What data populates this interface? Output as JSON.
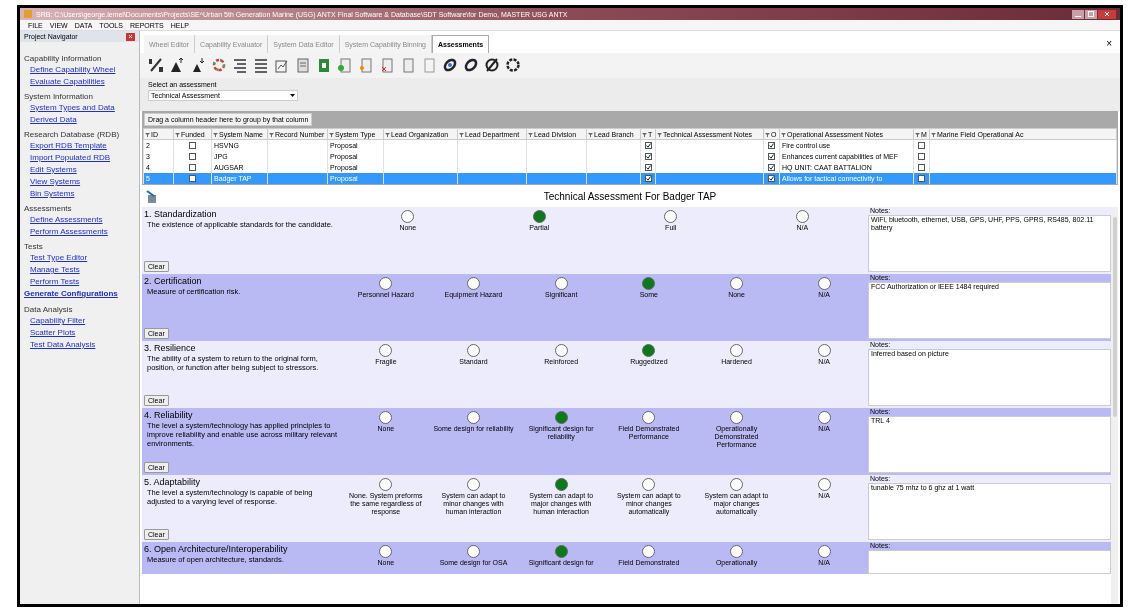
{
  "window": {
    "title": "SRB: C:\\Users\\george.lemel\\Documents\\Projects\\SE^Urban 5th Generation Marine (USG) ANTX Final Software & Database\\SDT Software\\for Demo, MASTER USG ANTX"
  },
  "menu": [
    "FILE",
    "VIEW",
    "DATA",
    "TOOLS",
    "REPORTS",
    "HELP"
  ],
  "navigator": {
    "title": "Project Navigator",
    "groups": [
      {
        "label": "Capability Information",
        "links": [
          "Define Capability Wheel",
          "Evaluate Capabilities"
        ]
      },
      {
        "label": "System Information",
        "links": [
          "System Types and Data",
          "Derived Data"
        ]
      },
      {
        "label": "Research Database (RDB)",
        "links": [
          "Export RDB Template",
          "Import Populated RDB",
          "Edit Systems",
          "View Systems",
          "Bin Systems"
        ]
      },
      {
        "label": "Assessments",
        "links": [
          "Define Assessments",
          "Perform Assessments"
        ]
      },
      {
        "label": "Tests",
        "links": [
          "Test Type Editor",
          "Manage Tests",
          "Perform Tests"
        ]
      },
      {
        "label": "Generate Configurations",
        "kind": "bold-link"
      },
      {
        "label": "Data Analysis",
        "links": [
          "Capability Filter",
          "Scatter Plots",
          "Test Data Analysis"
        ]
      }
    ]
  },
  "tabs": [
    {
      "label": "Wheel Editor",
      "selected": false
    },
    {
      "label": "Capability Evaluator",
      "selected": false
    },
    {
      "label": "System Data Editor",
      "selected": false
    },
    {
      "label": "System Capability Binning",
      "selected": false
    },
    {
      "label": "Assessments",
      "selected": true
    }
  ],
  "tab_close": "×",
  "assessment_select": {
    "label": "Select an assessment",
    "value": "Technical Assessment"
  },
  "group_hint": "Drag a column header here to group by that column",
  "table": {
    "columns": [
      "ID",
      "Funded",
      "System Name",
      "Record Number",
      "System Type",
      "Lead Organization",
      "Lead Department",
      "Lead Division",
      "Lead Branch",
      "T",
      "Technical Assessment Notes",
      "O",
      "Operational Assessment Notes",
      "M",
      "Marine Field Operational Ac"
    ],
    "rows": [
      {
        "id": "2",
        "funded": false,
        "name": "HSVNG",
        "type": "Proposal",
        "t": true,
        "o": true,
        "op_notes": "Fire control use",
        "m": false,
        "selected": false
      },
      {
        "id": "3",
        "funded": false,
        "name": "JPG",
        "type": "Proposal",
        "t": true,
        "o": true,
        "op_notes": "Enhances current capabilities of MEF",
        "m": false,
        "selected": false
      },
      {
        "id": "4",
        "funded": false,
        "name": "AUGSAR",
        "type": "Proposal",
        "t": true,
        "o": true,
        "op_notes": "HQ UNIT: CAAT BATTALION",
        "m": false,
        "selected": false
      },
      {
        "id": "5",
        "funded": false,
        "name": "Badger TAP",
        "type": "Proposal",
        "t": true,
        "o": true,
        "op_notes": "Allows for tactical connectivity to",
        "m": false,
        "selected": true
      }
    ]
  },
  "form": {
    "title": "Technical Assessment For Badger TAP",
    "criteria": [
      {
        "title": "1. Standardization",
        "description": "The existence of applicable standards for the candidate.",
        "clear_label": "Clear",
        "notes_label": "Notes:",
        "notes": "WiFi, bluetooth, ethernet, USB, GPS, UHF, PPS, GPRS, RS485, 802.11 battery",
        "options": [
          {
            "label": "None",
            "selected": false
          },
          {
            "label": "Partial",
            "selected": true
          },
          {
            "label": "Full",
            "selected": false
          },
          {
            "label": "N/A",
            "selected": false
          }
        ]
      },
      {
        "title": "2. Certification",
        "description": "Measure of certification risk.",
        "clear_label": "Clear",
        "notes_label": "Notes:",
        "notes": "FCC Authorization or IEEE 1484 required",
        "options": [
          {
            "label": "Personnel Hazard",
            "selected": false
          },
          {
            "label": "Equipment Hazard",
            "selected": false
          },
          {
            "label": "Significant",
            "selected": false
          },
          {
            "label": "Some",
            "selected": true
          },
          {
            "label": "None",
            "selected": false
          },
          {
            "label": "N/A",
            "selected": false
          }
        ]
      },
      {
        "title": "3. Resilience",
        "description": "The ability of a system to return to the original form, position, or function after being subject to stressors.",
        "clear_label": "Clear",
        "notes_label": "Notes:",
        "notes": "Inferred based on picture",
        "options": [
          {
            "label": "Fragile",
            "selected": false
          },
          {
            "label": "Standard",
            "selected": false
          },
          {
            "label": "Reinforced",
            "selected": false
          },
          {
            "label": "Ruggedized",
            "selected": true
          },
          {
            "label": "Hardened",
            "selected": false
          },
          {
            "label": "N/A",
            "selected": false
          }
        ]
      },
      {
        "title": "4. Reliability",
        "description": "The level a system/technology has applied principles to improve reliability and enable use across military relevant environments.",
        "clear_label": "Clear",
        "notes_label": "Notes:",
        "notes": "TRL 4",
        "options": [
          {
            "label": "None",
            "selected": false
          },
          {
            "label": "Some design for reliability",
            "selected": false
          },
          {
            "label": "Significant design for reliability",
            "selected": true
          },
          {
            "label": "Field Demonstrated Performance",
            "selected": false
          },
          {
            "label": "Operationally Demonstrated Performance",
            "selected": false
          },
          {
            "label": "N/A",
            "selected": false
          }
        ]
      },
      {
        "title": "5. Adaptability",
        "description": "The level a system/technology is capable of being adjusted to a varying level of response.",
        "clear_label": "Clear",
        "notes_label": "Notes:",
        "notes": "tunable 75 mhz to 6 ghz at 1 watt",
        "options": [
          {
            "label": "None. System preforms the same regardless of response",
            "selected": false
          },
          {
            "label": "System can adapt to minor changes with human interaction",
            "selected": false
          },
          {
            "label": "System can adapt to major changes with human interaction",
            "selected": true
          },
          {
            "label": "System can adapt to minor changes automatically",
            "selected": false
          },
          {
            "label": "System can adapt to major changes automatically",
            "selected": false
          },
          {
            "label": "N/A",
            "selected": false
          }
        ]
      },
      {
        "title": "6. Open Architecture/Interoperability",
        "description": "Measure of open architecture, standards.",
        "notes_label": "Notes:",
        "options": [
          {
            "label": "None",
            "selected": false
          },
          {
            "label": "Some design for OSA",
            "selected": false
          },
          {
            "label": "Significant design for",
            "selected": true
          },
          {
            "label": "Field Demonstrated",
            "selected": false
          },
          {
            "label": "Operationally",
            "selected": false
          },
          {
            "label": "N/A",
            "selected": false
          }
        ]
      }
    ]
  }
}
